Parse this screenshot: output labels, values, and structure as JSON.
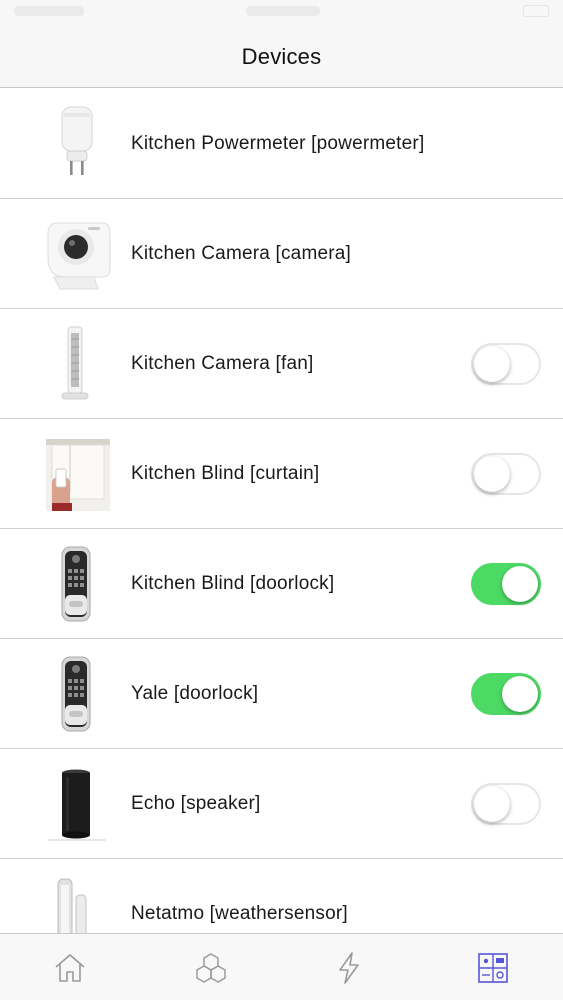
{
  "nav": {
    "title": "Devices"
  },
  "devices": [
    {
      "label": "Kitchen Powermeter [powermeter]",
      "icon": "powermeter-plug-icon",
      "toggle": null
    },
    {
      "label": "Kitchen Camera [camera]",
      "icon": "camera-icon",
      "toggle": null
    },
    {
      "label": "Kitchen Camera [fan]",
      "icon": "tower-fan-icon",
      "toggle": "off"
    },
    {
      "label": "Kitchen Blind [curtain]",
      "icon": "roller-blind-icon",
      "toggle": "off"
    },
    {
      "label": "Kitchen Blind [doorlock]",
      "icon": "doorlock-icon",
      "toggle": "on"
    },
    {
      "label": "Yale [doorlock]",
      "icon": "doorlock-icon",
      "toggle": "on"
    },
    {
      "label": " Echo [speaker]",
      "icon": "echo-speaker-icon",
      "toggle": "off"
    },
    {
      "label": "Netatmo [weathersensor]",
      "icon": "weather-sensor-icon",
      "toggle": null
    }
  ],
  "tabs": [
    {
      "icon": "home-icon",
      "selected": false
    },
    {
      "icon": "devices-cubes-icon",
      "selected": false
    },
    {
      "icon": "lightning-icon",
      "selected": false
    },
    {
      "icon": "rooms-grid-icon",
      "selected": true
    }
  ],
  "colors": {
    "toggle_on": "#4cd964",
    "tab_selected": "#5856d6",
    "tab_default": "#9a9a9a"
  }
}
